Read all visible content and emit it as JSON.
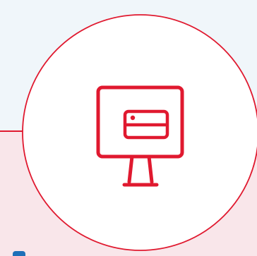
{
  "colors": {
    "background": "#f0f6fa",
    "panel": "#f9e6ea",
    "accent": "#e0192f",
    "circle_fill": "#ffffff",
    "edge_tab": "#1f6fb8"
  },
  "icon": {
    "name": "monitor-credit-card-icon"
  }
}
